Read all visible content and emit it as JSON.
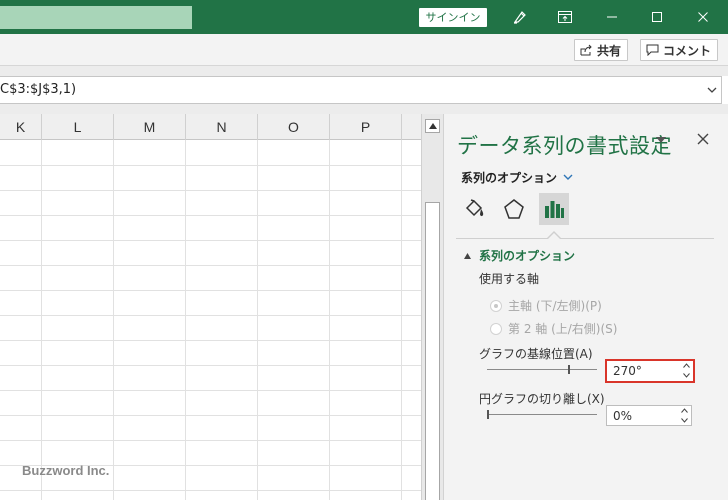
{
  "titlebar": {
    "signin_label": "サインイン"
  },
  "ribbon": {
    "share_label": "共有",
    "comment_label": "コメント"
  },
  "formula": {
    "text": "C$3:$J$3,1)"
  },
  "grid": {
    "columns": [
      "K",
      "L",
      "M",
      "N",
      "O",
      "P"
    ],
    "watermark": "Buzzword Inc."
  },
  "pane": {
    "title": "データ系列の書式設定",
    "options_dropdown": "系列のオプション",
    "section_title": "系列のオプション",
    "axis_label": "使用する軸",
    "primary_axis": "主軸 (下/左側)(P)",
    "secondary_axis": "第 2 軸 (上/右側)(S)",
    "rotation_label": "グラフの基線位置(A)",
    "rotation_value": "270°",
    "rotation_fraction": 0.75,
    "explosion_label": "円グラフの切り離し(X)",
    "explosion_value": "0%",
    "explosion_fraction": 0.0
  },
  "colors": {
    "accent": "#217346",
    "highlight_border": "#d9352a"
  },
  "icons": [
    "pen-icon",
    "maximize-icon",
    "minimize-icon",
    "restore-icon",
    "close-icon",
    "share-icon",
    "comment-icon",
    "fill-line-icon",
    "effects-icon",
    "series-options-icon",
    "pane-close-icon",
    "chevron-down-icon"
  ]
}
